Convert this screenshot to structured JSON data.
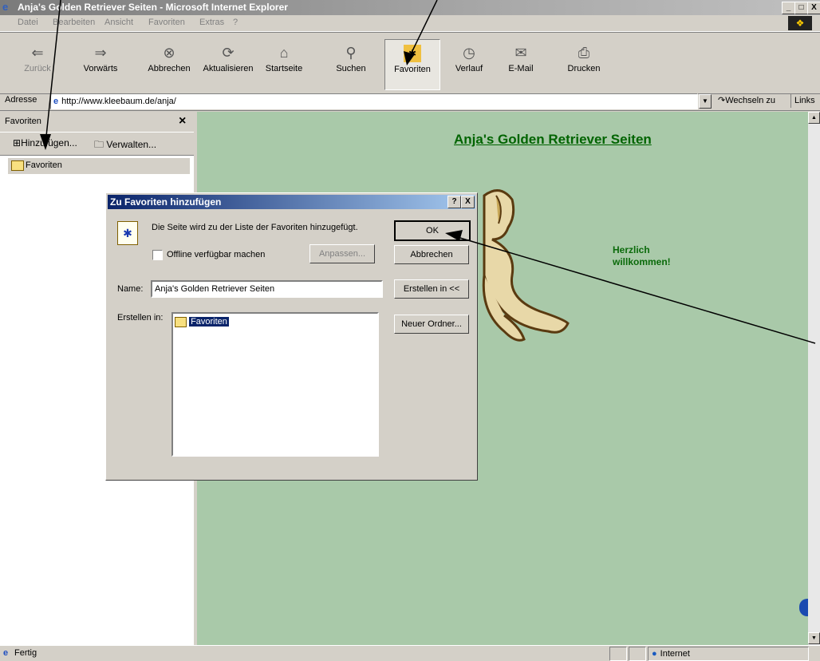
{
  "window": {
    "title": "Anja's Golden Retriever Seiten - Microsoft Internet Explorer",
    "minimize": "_",
    "maximize": "□",
    "close": "X"
  },
  "menu": [
    "Datei",
    "Bearbeiten",
    "Ansicht",
    "Favoriten",
    "Extras",
    "?"
  ],
  "toolbar": {
    "back": "Zurück",
    "forward": "Vorwärts",
    "stop": "Abbrechen",
    "refresh": "Aktualisieren",
    "home": "Startseite",
    "search": "Suchen",
    "favorites": "Favoriten",
    "history": "Verlauf",
    "mail": "E-Mail",
    "print": "Drucken"
  },
  "address": {
    "label": "Adresse",
    "url": "http://www.kleebaum.de/anja/",
    "go": "Wechseln zu",
    "links": "Links"
  },
  "sidebar": {
    "title": "Favoriten",
    "close": "×",
    "add": "Hinzufügen...",
    "manage": "Verwalten...",
    "folder": "Favoriten"
  },
  "page": {
    "heading": "Anja's Golden Retriever Seiten",
    "welcome_line1": "Herzlich",
    "welcome_line2": "willkommen!"
  },
  "dialog": {
    "title": "Zu Favoriten hinzufügen",
    "help": "?",
    "close": "X",
    "message": "Die Seite wird zu der Liste der Favoriten hinzugefügt.",
    "offline": "Offline verfügbar machen",
    "customize": "Anpassen...",
    "ok": "OK",
    "cancel": "Abbrechen",
    "name_label": "Name:",
    "name_value": "Anja's Golden Retriever Seiten",
    "create_in_btn": "Erstellen in <<",
    "create_in_label": "Erstellen in:",
    "new_folder": "Neuer Ordner...",
    "tree_item": "Favoriten"
  },
  "status": {
    "text": "Fertig",
    "zone": "Internet"
  },
  "colors": {
    "content_bg": "#a9c9a9",
    "heading": "#006400",
    "dialog_title": "#0a246a"
  }
}
